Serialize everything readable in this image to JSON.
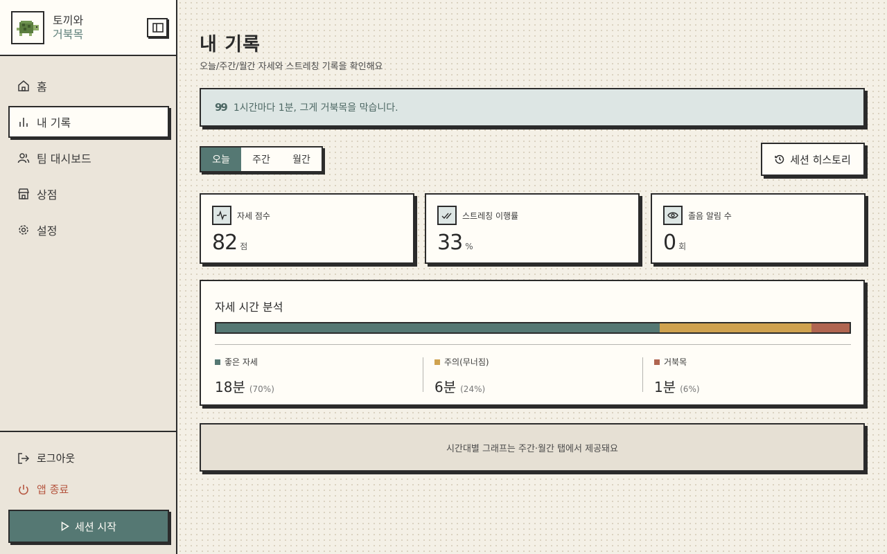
{
  "app": {
    "name_line1": "토끼와",
    "name_line2": "거북목"
  },
  "sidebar": {
    "items": [
      {
        "label": "홈",
        "icon": "home-icon"
      },
      {
        "label": "내 기록",
        "icon": "bar-chart-icon",
        "active": true
      },
      {
        "label": "팀 대시보드",
        "icon": "users-icon"
      },
      {
        "label": "상점",
        "icon": "store-icon"
      },
      {
        "label": "설정",
        "icon": "gear-icon"
      }
    ],
    "logout_label": "로그아웃",
    "exit_label": "앱 종료",
    "start_label": "세션 시작"
  },
  "page": {
    "title": "내 기록",
    "subtitle": "오늘/주간/월간 자세와 스트레칭 기록을 확인해요",
    "quote": "1시간마다 1분, 그게 거북목을 막습니다."
  },
  "tabs": {
    "today": "오늘",
    "weekly": "주간",
    "monthly": "월간",
    "selected": "오늘"
  },
  "history_label": "세션 히스토리",
  "cards": [
    {
      "label": "자세 점수",
      "value": "82",
      "unit": "점",
      "icon": "activity-icon"
    },
    {
      "label": "스트레칭 이행률",
      "value": "33",
      "unit": "%",
      "icon": "double-check-icon"
    },
    {
      "label": "졸음 알림 수",
      "value": "0",
      "unit": "회",
      "icon": "eye-icon"
    }
  ],
  "analysis": {
    "title": "자세 시간 분석",
    "segments": [
      {
        "label": "좋은 자세",
        "value": "18분",
        "pct": "(70%)",
        "fraction": 0.7,
        "color": "#557873"
      },
      {
        "label": "주의(무너짐)",
        "value": "6분",
        "pct": "(24%)",
        "fraction": 0.24,
        "color": "#cfa24f"
      },
      {
        "label": "거북목",
        "value": "1분",
        "pct": "(6%)",
        "fraction": 0.06,
        "color": "#b06550"
      }
    ]
  },
  "note": "시간대별 그래프는 주간·월간 탭에서 제공돼요",
  "colors": {
    "accent": "#557873",
    "warn": "#cfa24f",
    "danger": "#b06550",
    "exit": "#b5553f"
  }
}
